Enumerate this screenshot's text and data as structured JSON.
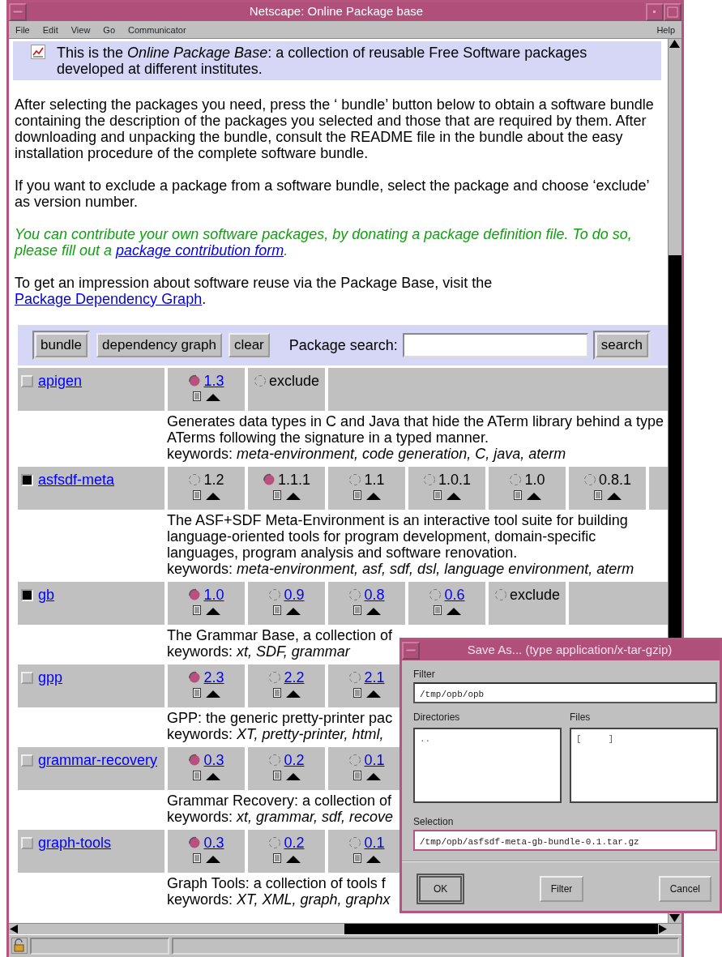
{
  "window": {
    "title": "Netscape: Online Package base"
  },
  "menu": [
    "File",
    "Edit",
    "View",
    "Go",
    "Communicator"
  ],
  "help_menu": "Help",
  "intro": [
    {
      "kind": "text",
      "text": "This is the "
    },
    {
      "kind": "italic",
      "text": "Online Package Base"
    },
    {
      "kind": "text",
      "text": ": a collection of reusable Free Software packages developed at different institutes."
    }
  ],
  "paragraphs": [
    {
      "kind": "normal",
      "segments": [
        {
          "kind": "text",
          "text": "After selecting the packages you need, press the ‘ bundle’ button below to obtain a software bundle containing the description of the packages you selected and those that are required by them. After downloading and unpacking the bundle, consult the README file in the bundle about the easy installation procedure of the complete software bundle."
        }
      ]
    },
    {
      "kind": "normal",
      "segments": [
        {
          "kind": "text",
          "text": "If you want to exclude a package from a software bundle, select the package and choose ‘exclude’ as version number."
        }
      ]
    },
    {
      "kind": "note",
      "segments": [
        {
          "kind": "text",
          "text": "You can contribute your own software packages, by donating a package definition file. To do so, please fill out a "
        },
        {
          "kind": "link",
          "text": "package contribution form"
        },
        {
          "kind": "text",
          "text": "."
        }
      ]
    },
    {
      "kind": "normal",
      "segments": [
        {
          "kind": "text",
          "text": "To get an impression about software reuse via the Package Base, visit the "
        },
        {
          "kind": "link",
          "text": "Package Dependency Graph"
        },
        {
          "kind": "text",
          "text": "."
        }
      ]
    }
  ],
  "toolbar": {
    "buttons": [
      "bundle",
      "dependency graph",
      "clear"
    ],
    "search_label": "Package search:",
    "search_button": "search"
  },
  "packages": [
    {
      "name": "apigen",
      "checked": false,
      "versions": [
        {
          "kind": "version",
          "label": "1.3",
          "selected": true,
          "linked": true
        },
        {
          "kind": "exclude",
          "label": "exclude",
          "selected": false
        },
        {
          "kind": "empty"
        }
      ],
      "description": [
        "Generates data types in C and Java that hide the ATerm library behind a type",
        "ATerms following the signature in a typed manner."
      ],
      "keywords": "keywords: *meta-environment, code generation, C, java, aterm*"
    },
    {
      "name": "asfsdf-meta",
      "checked": true,
      "versions": [
        {
          "kind": "version",
          "label": "1.2",
          "selected": false,
          "linked": false
        },
        {
          "kind": "version",
          "label": "1.1.1",
          "selected": true,
          "linked": false
        },
        {
          "kind": "version",
          "label": "1.1",
          "selected": false,
          "linked": false
        },
        {
          "kind": "version",
          "label": "1.0.1",
          "selected": false,
          "linked": false
        },
        {
          "kind": "version",
          "label": "1.0",
          "selected": false,
          "linked": false
        },
        {
          "kind": "version",
          "label": "0.8.1",
          "selected": false,
          "linked": false
        },
        {
          "kind": "empty"
        }
      ],
      "description": [
        "The ASF+SDF Meta-Environment is an interactive tool suite for building",
        "language-oriented tools for program development, domain-specific",
        "languages, program analysis and software renovation."
      ],
      "keywords": "keywords: *meta-environment, asf, sdf, dsl, language environment, aterm*"
    },
    {
      "name": "gb",
      "checked": true,
      "versions": [
        {
          "kind": "version",
          "label": "1.0",
          "selected": true,
          "linked": true
        },
        {
          "kind": "version",
          "label": "0.9",
          "selected": false,
          "linked": true
        },
        {
          "kind": "version",
          "label": "0.8",
          "selected": false,
          "linked": true
        },
        {
          "kind": "version",
          "label": "0.6",
          "selected": false,
          "linked": true
        },
        {
          "kind": "exclude",
          "label": "exclude",
          "selected": false
        },
        {
          "kind": "empty"
        }
      ],
      "description": [
        "The Grammar Base, a collection of"
      ],
      "keywords": "keywords: *xt, SDF, grammar*"
    },
    {
      "name": "gpp",
      "checked": false,
      "versions": [
        {
          "kind": "version",
          "label": "2.3",
          "selected": true,
          "linked": true
        },
        {
          "kind": "version",
          "label": "2.2",
          "selected": false,
          "linked": true
        },
        {
          "kind": "version",
          "label": "2.1",
          "selected": false,
          "linked": true
        }
      ],
      "description": [
        "GPP: the generic pretty-printer pac"
      ],
      "keywords": "keywords: *XT, pretty-printer, html,*"
    },
    {
      "name": "grammar-recovery",
      "checked": false,
      "versions": [
        {
          "kind": "version",
          "label": "0.3",
          "selected": true,
          "linked": true
        },
        {
          "kind": "version",
          "label": "0.2",
          "selected": false,
          "linked": true
        },
        {
          "kind": "version",
          "label": "0.1",
          "selected": false,
          "linked": true
        }
      ],
      "description": [
        "Grammar Recovery: a collection of"
      ],
      "keywords": "keywords: *xt, grammar, sdf, recove*"
    },
    {
      "name": "graph-tools",
      "checked": false,
      "versions": [
        {
          "kind": "version",
          "label": "0.3",
          "selected": true,
          "linked": true
        },
        {
          "kind": "version",
          "label": "0.2",
          "selected": false,
          "linked": true
        },
        {
          "kind": "version",
          "label": "0.1",
          "selected": false,
          "linked": true
        }
      ],
      "description": [
        "Graph Tools: a collection of tools f"
      ],
      "keywords": "keywords: *XT, XML, graph, graphx*"
    }
  ],
  "dialog": {
    "title": "Save As... (type application/x-tar-gzip)",
    "filter_label": "Filter",
    "filter_value": "/tmp/opb/opb",
    "directories_label": "Directories",
    "directories": [
      ".."
    ],
    "files_label": "Files",
    "files": [
      "[     ]"
    ],
    "selection_label": "Selection",
    "selection_value": "/tmp/opb/asfsdf-meta-gb-bundle-0.1.tar.gz",
    "buttons": [
      {
        "label": "OK",
        "default": true
      },
      {
        "label": "Filter",
        "default": false
      },
      {
        "label": "Cancel",
        "default": false
      }
    ]
  }
}
